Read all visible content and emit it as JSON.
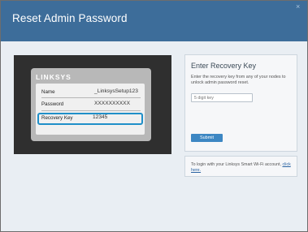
{
  "header": {
    "title": "Reset Admin Password",
    "close_glyph": "×",
    "color": "#3d6d9a"
  },
  "device_label": {
    "brand": "LINKSYS",
    "rows": [
      {
        "key": "Name",
        "value": "_LinksysSetup123"
      },
      {
        "key": "Password",
        "value": "XXXXXXXXXX"
      },
      {
        "key": "Recovery Key",
        "value": "12345"
      }
    ],
    "highlight_color": "#1f8fc8"
  },
  "recovery_panel": {
    "title": "Enter Recovery Key",
    "description": "Enter the recovery key from any of your nodes to unlock admin password reset.",
    "input": {
      "value": "",
      "placeholder": "5 digit key"
    },
    "submit_label": "Submit"
  },
  "login_panel": {
    "text": "To login with your Linksys Smart Wi-Fi account,",
    "link_text": "click here."
  }
}
